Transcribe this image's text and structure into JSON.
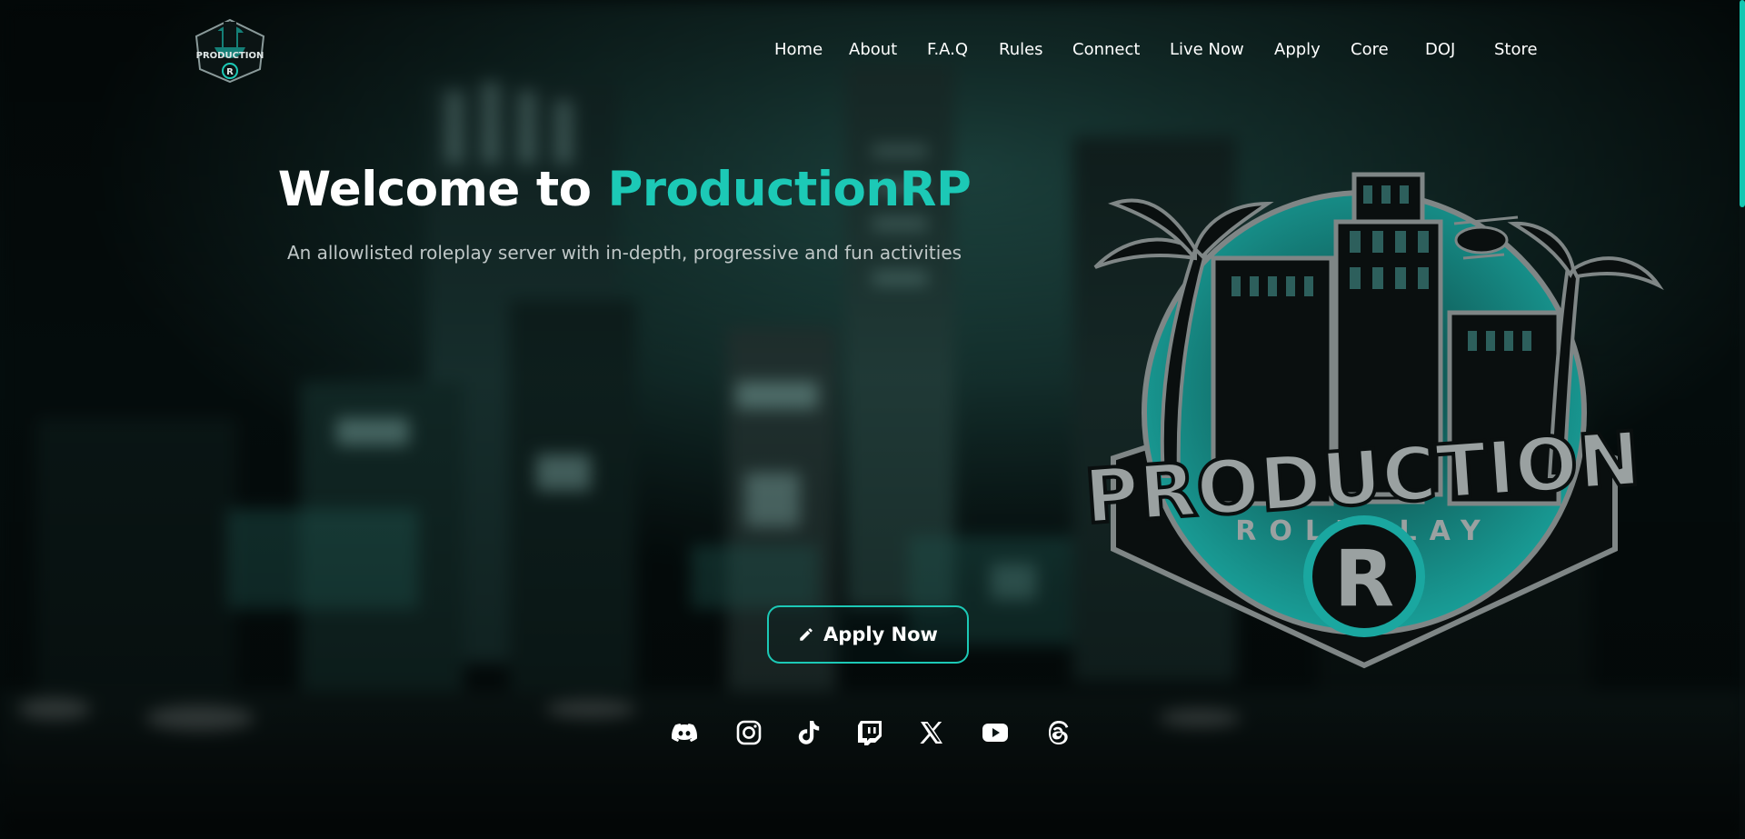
{
  "header": {
    "logo": {
      "name": "production-roleplay-logo"
    },
    "nav": [
      {
        "label": "Home"
      },
      {
        "label": "About"
      },
      {
        "label": "F.A.Q"
      },
      {
        "label": "Rules"
      },
      {
        "label": "Connect"
      },
      {
        "label": "Live Now"
      },
      {
        "label": "Apply"
      },
      {
        "label": "Core"
      },
      {
        "label": "DOJ"
      },
      {
        "label": "Store"
      }
    ]
  },
  "hero": {
    "title_prefix": "Welcome to ",
    "title_accent": "ProductionRP",
    "subtitle": "An allowlisted roleplay server with in-depth, progressive and fun activities",
    "apply_button": {
      "label": "Apply Now",
      "icon": "pencil-icon"
    }
  },
  "socials": [
    {
      "name": "discord",
      "icon": "discord-icon"
    },
    {
      "name": "instagram",
      "icon": "instagram-icon"
    },
    {
      "name": "tiktok",
      "icon": "tiktok-icon"
    },
    {
      "name": "twitch",
      "icon": "twitch-icon"
    },
    {
      "name": "x",
      "icon": "x-icon"
    },
    {
      "name": "youtube",
      "icon": "youtube-icon"
    },
    {
      "name": "threads",
      "icon": "threads-icon"
    }
  ],
  "logo_large": {
    "word1": "PRODUCTION",
    "word2": "ROLEPLAY",
    "monogram": "R"
  },
  "colors": {
    "accent": "#1cc9b6",
    "background": "#071414",
    "text": "#ffffff",
    "subtitle": "#bfc7c7"
  }
}
